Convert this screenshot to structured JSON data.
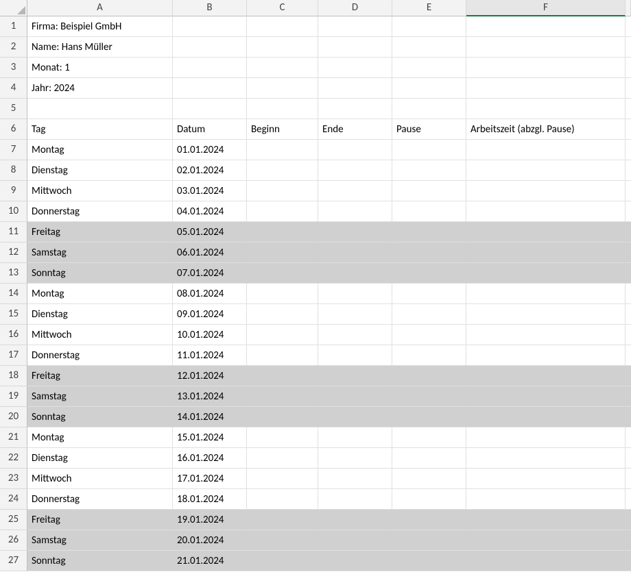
{
  "columns": [
    "A",
    "B",
    "C",
    "D",
    "E",
    "F"
  ],
  "selectedColumn": "F",
  "info": {
    "firma": "Firma: Beispiel GmbH",
    "name": "Name: Hans Müller",
    "monat": "Monat: 1",
    "jahr": "Jahr: 2024"
  },
  "headers": {
    "tag": "Tag",
    "datum": "Datum",
    "beginn": "Beginn",
    "ende": "Ende",
    "pause": "Pause",
    "arbeitszeit": "Arbeitszeit (abzgl. Pause)"
  },
  "rows": [
    {
      "n": 1,
      "a": "Firma: Beispiel GmbH",
      "b": "",
      "shaded": false
    },
    {
      "n": 2,
      "a": "Name: Hans Müller",
      "b": "",
      "shaded": false
    },
    {
      "n": 3,
      "a": "Monat: 1",
      "b": "",
      "shaded": false
    },
    {
      "n": 4,
      "a": "Jahr: 2024",
      "b": "",
      "shaded": false
    },
    {
      "n": 5,
      "a": "",
      "b": "",
      "shaded": false
    },
    {
      "n": 6,
      "a": "Tag",
      "b": "Datum",
      "c": "Beginn",
      "d": "Ende",
      "e": "Pause",
      "f": "Arbeitszeit (abzgl. Pause)",
      "shaded": false
    },
    {
      "n": 7,
      "a": "Montag",
      "b": "01.01.2024",
      "shaded": false
    },
    {
      "n": 8,
      "a": "Dienstag",
      "b": "02.01.2024",
      "shaded": false
    },
    {
      "n": 9,
      "a": "Mittwoch",
      "b": "03.01.2024",
      "shaded": false
    },
    {
      "n": 10,
      "a": "Donnerstag",
      "b": "04.01.2024",
      "shaded": false
    },
    {
      "n": 11,
      "a": "Freitag",
      "b": "05.01.2024",
      "shaded": true
    },
    {
      "n": 12,
      "a": "Samstag",
      "b": "06.01.2024",
      "shaded": true
    },
    {
      "n": 13,
      "a": "Sonntag",
      "b": "07.01.2024",
      "shaded": true
    },
    {
      "n": 14,
      "a": "Montag",
      "b": "08.01.2024",
      "shaded": false
    },
    {
      "n": 15,
      "a": "Dienstag",
      "b": "09.01.2024",
      "shaded": false
    },
    {
      "n": 16,
      "a": "Mittwoch",
      "b": "10.01.2024",
      "shaded": false
    },
    {
      "n": 17,
      "a": "Donnerstag",
      "b": "11.01.2024",
      "shaded": false
    },
    {
      "n": 18,
      "a": "Freitag",
      "b": "12.01.2024",
      "shaded": true
    },
    {
      "n": 19,
      "a": "Samstag",
      "b": "13.01.2024",
      "shaded": true
    },
    {
      "n": 20,
      "a": "Sonntag",
      "b": "14.01.2024",
      "shaded": true
    },
    {
      "n": 21,
      "a": "Montag",
      "b": "15.01.2024",
      "shaded": false
    },
    {
      "n": 22,
      "a": "Dienstag",
      "b": "16.01.2024",
      "shaded": false
    },
    {
      "n": 23,
      "a": "Mittwoch",
      "b": "17.01.2024",
      "shaded": false
    },
    {
      "n": 24,
      "a": "Donnerstag",
      "b": "18.01.2024",
      "shaded": false
    },
    {
      "n": 25,
      "a": "Freitag",
      "b": "19.01.2024",
      "shaded": true
    },
    {
      "n": 26,
      "a": "Samstag",
      "b": "20.01.2024",
      "shaded": true
    },
    {
      "n": 27,
      "a": "Sonntag",
      "b": "21.01.2024",
      "shaded": true
    }
  ]
}
